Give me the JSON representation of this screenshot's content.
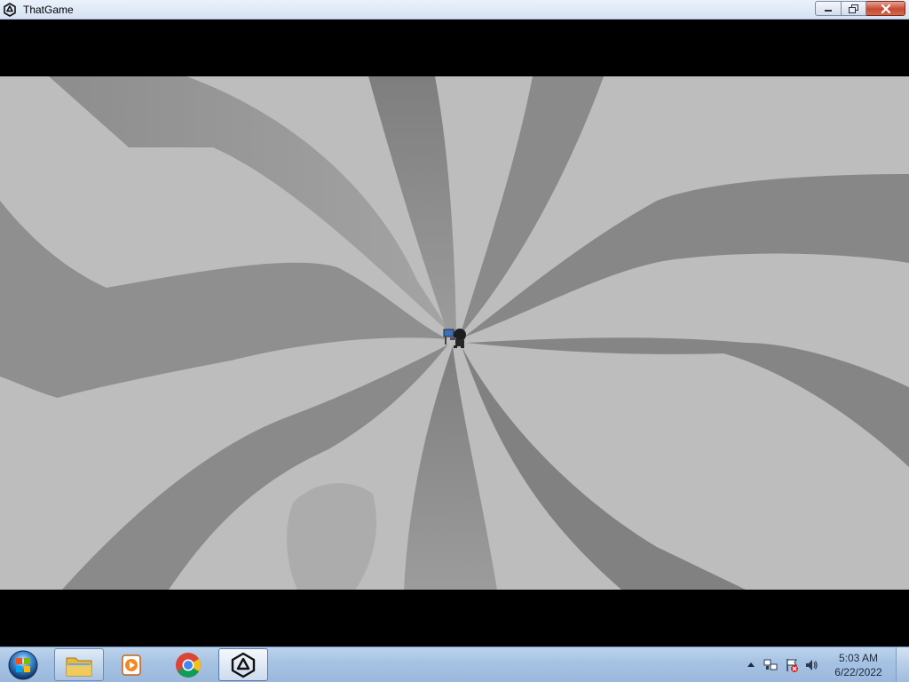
{
  "window": {
    "title": "ThatGame",
    "app_icon": "unity-icon",
    "buttons": {
      "minimize": "minimize-icon",
      "maximize": "restore-icon",
      "close": "close-icon"
    }
  },
  "game": {
    "background_color": "#bdbdbd",
    "stripe_color": "#7a7a7a",
    "character": "player-character-sprite"
  },
  "taskbar": {
    "start": "windows-start-orb",
    "items": [
      {
        "name": "file-explorer",
        "icon": "folder-icon",
        "active": false
      },
      {
        "name": "media-player",
        "icon": "media-player-icon",
        "active": false
      },
      {
        "name": "chrome",
        "icon": "chrome-icon",
        "active": false
      },
      {
        "name": "unity",
        "icon": "unity-icon",
        "active": true
      }
    ],
    "tray": {
      "icons": [
        "show-hidden-icons-arrow",
        "network-icon",
        "action-center-flag-icon",
        "volume-icon"
      ],
      "time": "5:03 AM",
      "date": "6/22/2022"
    }
  }
}
